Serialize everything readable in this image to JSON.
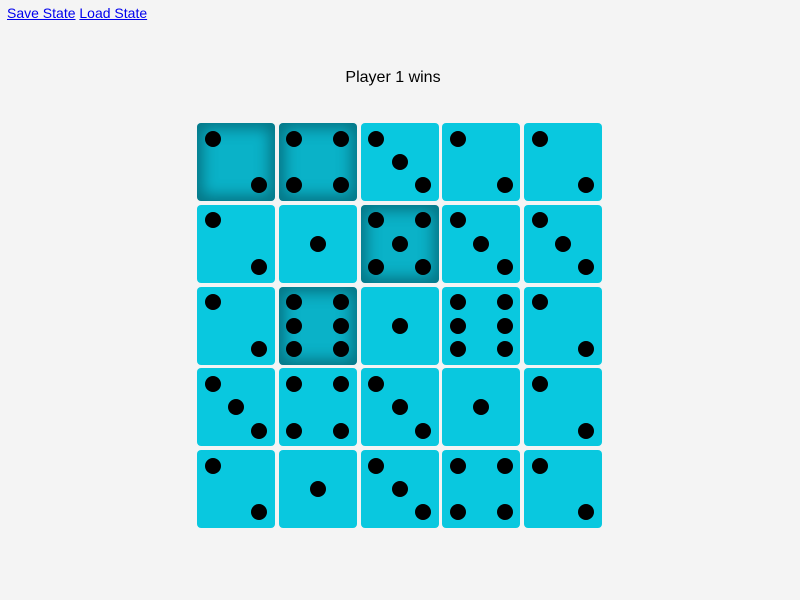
{
  "links": {
    "save_state": "Save State",
    "load_state": "Load State"
  },
  "status_text": "Player 1 wins",
  "colors": {
    "die": "#09c8df",
    "die_selected": "#0ab2c8",
    "pip": "#000000",
    "background": "#f4f4f4"
  },
  "board": {
    "rows": 5,
    "cols": 5,
    "dice": [
      {
        "value": 2,
        "selected": true
      },
      {
        "value": 4,
        "selected": true
      },
      {
        "value": 3,
        "selected": false
      },
      {
        "value": 2,
        "selected": false
      },
      {
        "value": 2,
        "selected": false
      },
      {
        "value": 2,
        "selected": false
      },
      {
        "value": 1,
        "selected": false
      },
      {
        "value": 5,
        "selected": true
      },
      {
        "value": 3,
        "selected": false
      },
      {
        "value": 3,
        "selected": false
      },
      {
        "value": 2,
        "selected": false
      },
      {
        "value": 6,
        "selected": true
      },
      {
        "value": 1,
        "selected": false
      },
      {
        "value": 6,
        "selected": false
      },
      {
        "value": 2,
        "selected": false
      },
      {
        "value": 3,
        "selected": false
      },
      {
        "value": 4,
        "selected": false
      },
      {
        "value": 3,
        "selected": false
      },
      {
        "value": 1,
        "selected": false
      },
      {
        "value": 2,
        "selected": false
      },
      {
        "value": 2,
        "selected": false
      },
      {
        "value": 1,
        "selected": false
      },
      {
        "value": 3,
        "selected": false
      },
      {
        "value": 4,
        "selected": false
      },
      {
        "value": 2,
        "selected": false
      }
    ]
  }
}
